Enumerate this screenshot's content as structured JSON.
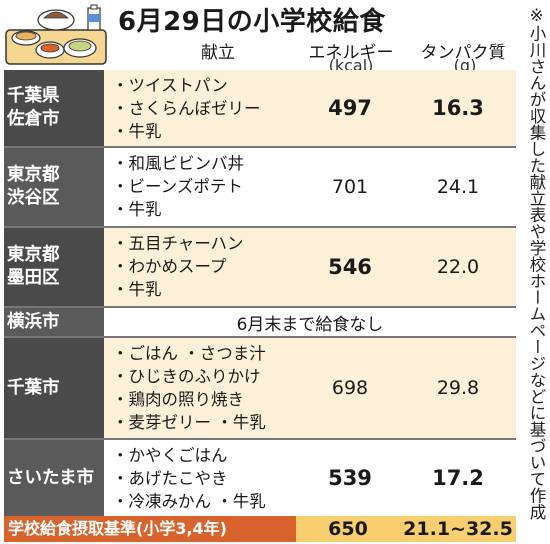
{
  "title": "6月29日の小学校給食",
  "icons": {
    "tray": "school-lunch-tray-illustration"
  },
  "columns": {
    "menu": "献立",
    "energy": "エネルギー",
    "energy_unit": "(kcal)",
    "protein": "タンパク質",
    "protein_unit": "(g)"
  },
  "rows": [
    {
      "region_lines": [
        "千葉県",
        "佐倉市"
      ],
      "menu": [
        "・ツイストパン",
        "・さくらんぼゼリー",
        "・牛乳"
      ],
      "energy": "497",
      "protein": "16.3",
      "bold": true
    },
    {
      "region_lines": [
        "東京都",
        "渋谷区"
      ],
      "menu": [
        "・和風ビビンバ丼",
        "・ビーンズポテト",
        "・牛乳"
      ],
      "energy": "701",
      "protein": "24.1",
      "bold": false
    },
    {
      "region_lines": [
        "東京都",
        "墨田区"
      ],
      "menu": [
        "・五目チャーハン",
        "・わかめスープ",
        "・牛乳"
      ],
      "energy": "546",
      "protein": "22.0",
      "bold": true
    },
    {
      "region_lines": [
        "横浜市"
      ],
      "note": "6月末まで給食なし"
    },
    {
      "region_lines": [
        "千葉市"
      ],
      "menu": [
        "・ごはん ・さつま汁",
        "・ひじきのふりかけ",
        "・鶏肉の照り焼き",
        "・麦芽ゼリー ・牛乳"
      ],
      "energy": "698",
      "protein": "29.8",
      "bold": false
    },
    {
      "region_lines": [
        "さいたま市"
      ],
      "menu": [
        "・かやくごはん",
        "・あげたこやき",
        "・冷凍みかん ・牛乳"
      ],
      "energy": "539",
      "protein": "17.2",
      "bold": true
    }
  ],
  "footer": {
    "label": "学校給食摂取基準(小学3,4年)",
    "energy": "650",
    "protein": "21.1~32.5"
  },
  "side_note": "※小川さんが収集した献立表や学校ホームページなどに基づいて作成",
  "colors": {
    "region_bg": "#4a4a4a",
    "row_shade": "#fdf0d8",
    "footer_label_bg": "#d9632d",
    "footer_bg": "#f7cf6e"
  }
}
